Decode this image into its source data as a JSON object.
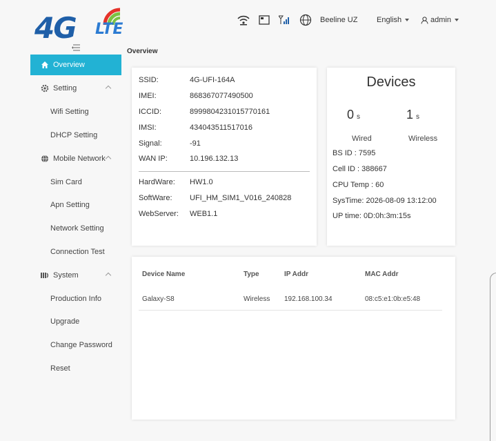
{
  "header": {
    "logo_main": "4G",
    "logo_sub": "LTE",
    "operator": "Beeline UZ",
    "language": "English",
    "user": "admin"
  },
  "page_title": "Overview",
  "sidebar": {
    "items": [
      {
        "label": "Overview",
        "icon": "home-icon",
        "active": true
      },
      {
        "label": "Setting",
        "icon": "gear-icon"
      },
      {
        "label": "Wifi Setting"
      },
      {
        "label": "DHCP Setting"
      },
      {
        "label": "Mobile Network",
        "icon": "globe-icon"
      },
      {
        "label": "Sim Card"
      },
      {
        "label": "Apn Setting"
      },
      {
        "label": "Network Setting"
      },
      {
        "label": "Connection Test"
      },
      {
        "label": "System",
        "icon": "system-icon"
      },
      {
        "label": "Production Info"
      },
      {
        "label": "Upgrade"
      },
      {
        "label": "Change Password"
      },
      {
        "label": "Reset"
      }
    ]
  },
  "info": {
    "ssid_label": "SSID:",
    "ssid": "4G-UFI-164A",
    "imei_label": "IMEI:",
    "imei": "868367077490500",
    "iccid_label": "ICCID:",
    "iccid": "8999804231015770161",
    "imsi_label": "IMSI:",
    "imsi": "434043511517016",
    "signal_label": "Signal:",
    "signal": "-91",
    "wanip_label": "WAN IP:",
    "wanip": "10.196.132.13",
    "hardware_label": "HardWare:",
    "hardware": "HW1.0",
    "software_label": "SoftWare:",
    "software": "UFI_HM_SIM1_V016_240828",
    "webserver_label": "WebServer:",
    "webserver": "WEB1.1"
  },
  "devices": {
    "title": "Devices",
    "wired_count": "0",
    "wired_unit": "s",
    "wireless_count": "1",
    "wireless_unit": "s",
    "wired_label": "Wired",
    "wireless_label": "Wireless",
    "bs_id": "BS ID : 7595",
    "cell_id": "Cell ID : 388667",
    "cpu_temp": "CPU Temp : 60",
    "systime": "SysTime: 2026-08-09 13:12:00",
    "uptime": "UP time: 0D:0h:3m:15s"
  },
  "table": {
    "headers": [
      "Device Name",
      "Type",
      "IP Addr",
      "MAC Addr"
    ],
    "rows": [
      [
        "Galaxy-S8",
        "Wireless",
        "192.168.100.34",
        "08:c5:e1:0b:e5:48"
      ]
    ]
  },
  "colors": {
    "accent": "#22b2d4",
    "logo_blue": "#1f5fa8",
    "logo_green": "#7cc242",
    "logo_red": "#e5332a"
  }
}
